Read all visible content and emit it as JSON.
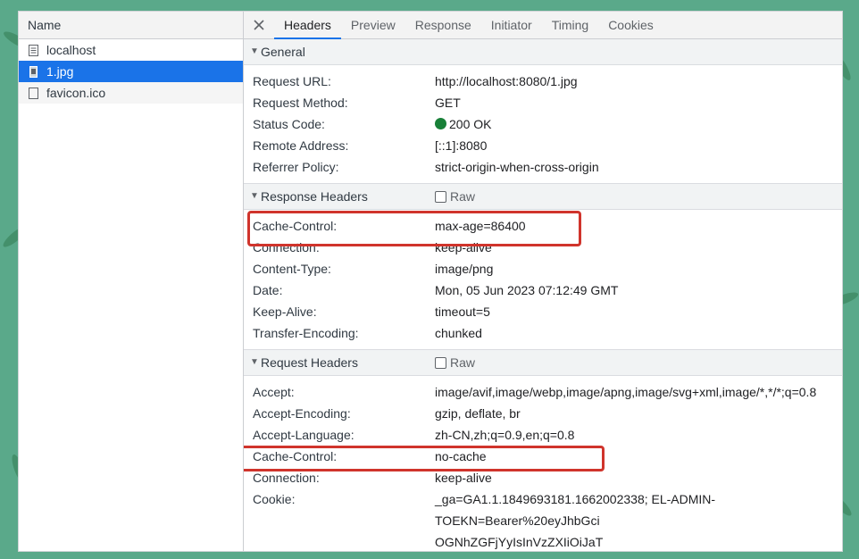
{
  "requests_panel": {
    "column_header": "Name",
    "items": [
      {
        "name": "localhost",
        "icon": "document-icon"
      },
      {
        "name": "1.jpg",
        "icon": "image-file-icon",
        "selected": true
      },
      {
        "name": "favicon.ico",
        "icon": "blank-file-icon"
      }
    ]
  },
  "tabs": [
    "Headers",
    "Preview",
    "Response",
    "Initiator",
    "Timing",
    "Cookies"
  ],
  "active_tab": "Headers",
  "general": {
    "title": "General",
    "rows": [
      {
        "key": "Request URL:",
        "value": "http://localhost:8080/1.jpg"
      },
      {
        "key": "Request Method:",
        "value": "GET"
      },
      {
        "key": "Status Code:",
        "value": "200 OK"
      },
      {
        "key": "Remote Address:",
        "value": "[::1]:8080"
      },
      {
        "key": "Referrer Policy:",
        "value": "strict-origin-when-cross-origin"
      }
    ]
  },
  "response_headers": {
    "title": "Response Headers",
    "raw_label": "Raw",
    "rows": [
      {
        "key": "Cache-Control:",
        "value": "max-age=86400"
      },
      {
        "key": "Connection:",
        "value": "keep-alive"
      },
      {
        "key": "Content-Type:",
        "value": "image/png"
      },
      {
        "key": "Date:",
        "value": "Mon, 05 Jun 2023 07:12:49 GMT"
      },
      {
        "key": "Keep-Alive:",
        "value": "timeout=5"
      },
      {
        "key": "Transfer-Encoding:",
        "value": "chunked"
      }
    ]
  },
  "request_headers": {
    "title": "Request Headers",
    "raw_label": "Raw",
    "rows": [
      {
        "key": "Accept:",
        "value": "image/avif,image/webp,image/apng,image/svg+xml,image/*,*/*;q=0.8"
      },
      {
        "key": "Accept-Encoding:",
        "value": "gzip, deflate, br"
      },
      {
        "key": "Accept-Language:",
        "value": "zh-CN,zh;q=0.9,en;q=0.8"
      },
      {
        "key": "Cache-Control:",
        "value": "no-cache"
      },
      {
        "key": "Connection:",
        "value": "keep-alive"
      },
      {
        "key": "Cookie:",
        "value": "_ga=GA1.1.1849693181.1662002338; EL-ADMIN-"
      }
    ],
    "cookie_continued": [
      "TOEKN=Bearer%20eyJhbGci",
      "OGNhZGFjYyIsInVzZXIiOiJaT"
    ]
  },
  "colors": {
    "accent": "#1a73e8",
    "status_ok": "#188038",
    "highlight": "#d0342c",
    "background": "#5aa98a"
  }
}
